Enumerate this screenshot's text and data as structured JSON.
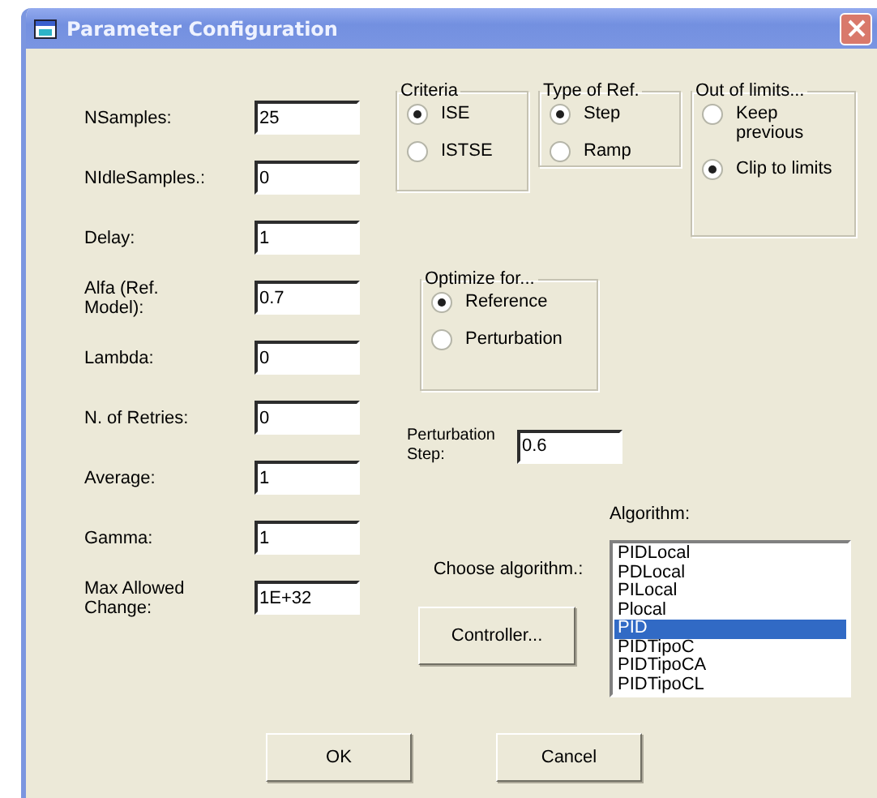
{
  "window": {
    "title": "Parameter Configuration"
  },
  "parameters": [
    {
      "label": "NSamples:",
      "value": "25"
    },
    {
      "label": "NIdleSamples.:",
      "value": "0"
    },
    {
      "label": "Delay:",
      "value": "1"
    },
    {
      "label": "Alfa (Ref. Model):",
      "value": "0.7"
    },
    {
      "label": "Lambda:",
      "value": "0"
    },
    {
      "label": "N. of Retries:",
      "value": "0"
    },
    {
      "label": "Average:",
      "value": "1"
    },
    {
      "label": "Gamma:",
      "value": "1"
    },
    {
      "label": "Max Allowed Change:",
      "value": "1E+32"
    }
  ],
  "option_groups": [
    {
      "title": "Criteria",
      "options": [
        {
          "label": "ISE",
          "selected": true
        },
        {
          "label": "ISTSE",
          "selected": false
        }
      ]
    },
    {
      "title": "Type of Ref.",
      "options": [
        {
          "label": "Step",
          "selected": true
        },
        {
          "label": "Ramp",
          "selected": false
        }
      ]
    },
    {
      "title": "Out of limits...",
      "options": [
        {
          "label": "Keep previous",
          "selected": false
        },
        {
          "label": "Clip to limits",
          "selected": true
        }
      ]
    }
  ],
  "optimize_for": {
    "title": "Optimize for...",
    "options": [
      {
        "label": "Reference",
        "selected": true
      },
      {
        "label": "Perturbation",
        "selected": false
      }
    ]
  },
  "perturbation_step": {
    "label": "Perturbation Step:",
    "value": "0.6"
  },
  "algorithm": {
    "choose_label": "Choose algorithm.:",
    "label": "Algorithm:",
    "items": [
      {
        "label": "PIDLocal",
        "selected": false
      },
      {
        "label": "PDLocal",
        "selected": false
      },
      {
        "label": "PILocal",
        "selected": false
      },
      {
        "label": "Plocal",
        "selected": false
      },
      {
        "label": "PID",
        "selected": true
      },
      {
        "label": "PIDTipoC",
        "selected": false
      },
      {
        "label": "PIDTipoCA",
        "selected": false
      },
      {
        "label": "PIDTipoCL",
        "selected": false
      }
    ]
  },
  "controller_button": "Controller...",
  "buttons": [
    "OK",
    "Cancel"
  ]
}
